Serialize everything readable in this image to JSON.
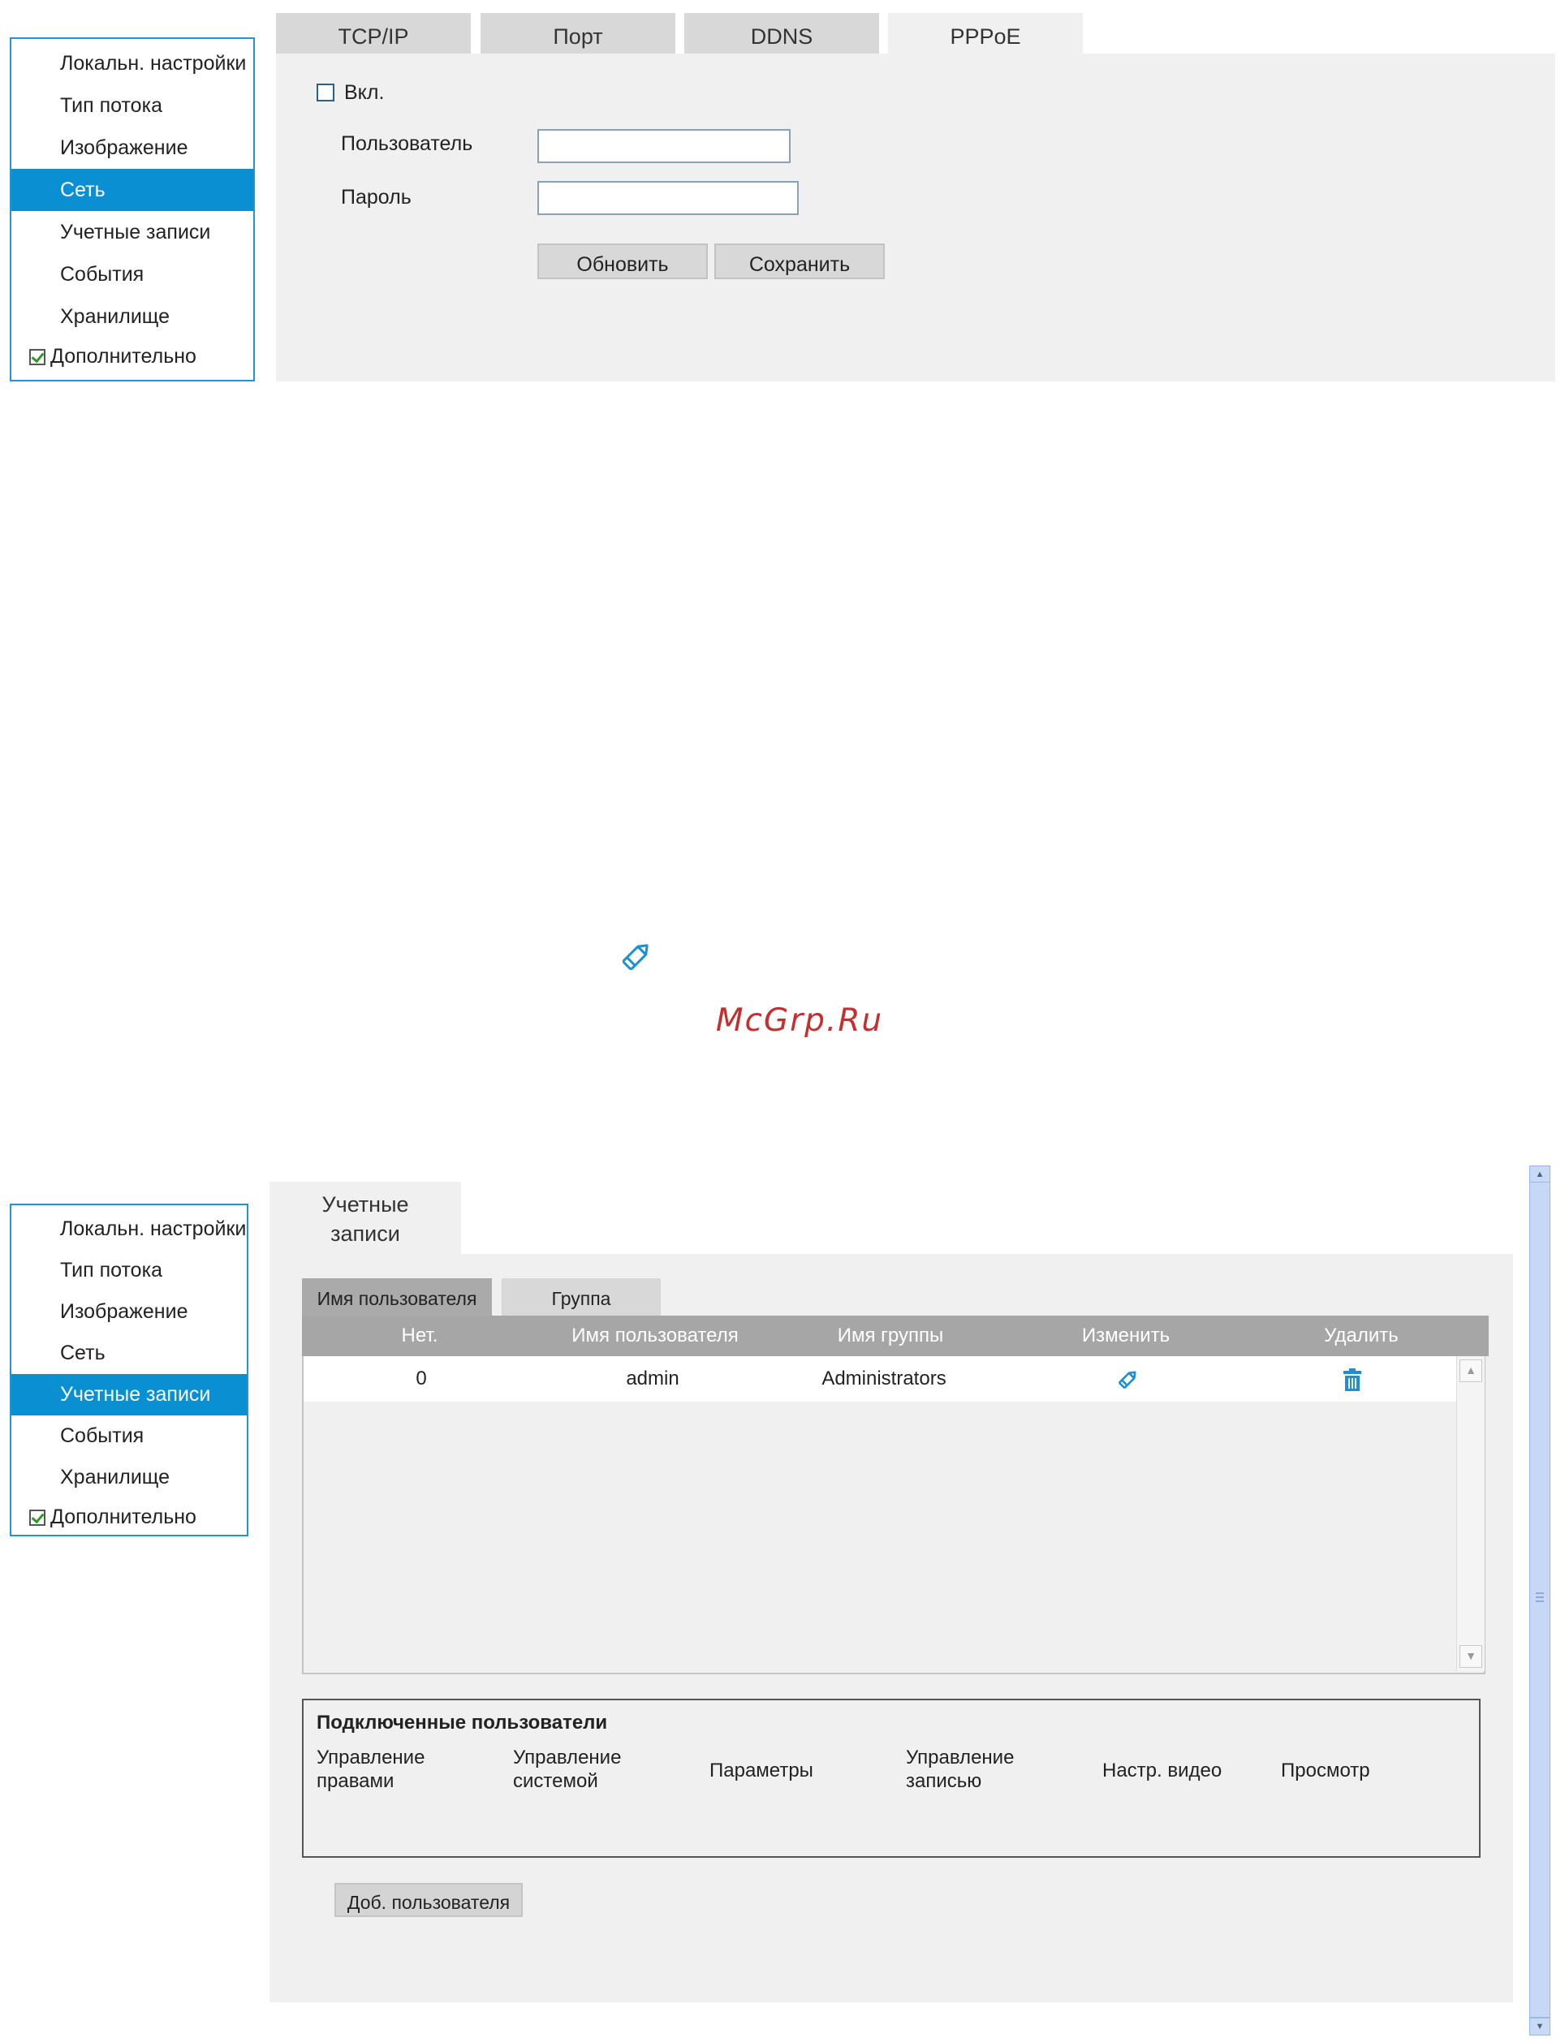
{
  "network_screen": {
    "sidebar": {
      "items": [
        {
          "label": "Локальн. настройки",
          "active": false
        },
        {
          "label": "Тип потока",
          "active": false
        },
        {
          "label": "Изображение",
          "active": false
        },
        {
          "label": "Сеть",
          "active": true
        },
        {
          "label": "Учетные записи",
          "active": false
        },
        {
          "label": "События",
          "active": false
        },
        {
          "label": "Хранилище",
          "active": false
        }
      ],
      "advanced": {
        "label": "Дополнительно",
        "checked": true
      }
    },
    "tabs": [
      "TCP/IP",
      "Порт",
      "DDNS",
      "PPPoE"
    ],
    "active_tab": "PPPoE",
    "pppoe": {
      "enable_label": "Вкл.",
      "enabled": false,
      "user_label": "Пользователь",
      "user_value": "",
      "password_label": "Пароль",
      "password_value": "",
      "refresh_button": "Обновить",
      "save_button": "Сохранить"
    }
  },
  "watermark": {
    "text": "McGrp.Ru",
    "icon": "pencil-icon"
  },
  "accounts_screen": {
    "sidebar": {
      "items": [
        {
          "label": "Локальн. настройки",
          "active": false
        },
        {
          "label": "Тип потока",
          "active": false
        },
        {
          "label": "Изображение",
          "active": false
        },
        {
          "label": "Сеть",
          "active": false
        },
        {
          "label": "Учетные записи",
          "active": true
        },
        {
          "label": "События",
          "active": false
        },
        {
          "label": "Хранилище",
          "active": false
        }
      ],
      "advanced": {
        "label": "Дополнительно",
        "checked": true
      }
    },
    "main_tab": {
      "line1": "Учетные",
      "line2": "записи"
    },
    "subtabs": [
      "Имя пользователя",
      "Группа"
    ],
    "active_subtab": "Имя пользователя",
    "table": {
      "headers": [
        "Нет.",
        "Имя пользователя",
        "Имя группы",
        "Изменить",
        "Удалить"
      ],
      "rows": [
        {
          "no": "0",
          "user": "admin",
          "group": "Administrators",
          "edit_icon": "pencil-icon",
          "delete_icon": "trash-icon"
        }
      ]
    },
    "connected": {
      "title": "Подключенные пользователи",
      "columns": [
        {
          "l1": "Управление",
          "l2": "правами"
        },
        {
          "l1": "Управление",
          "l2": "системой"
        },
        {
          "l1": "Параметры",
          "l2": ""
        },
        {
          "l1": "Управление",
          "l2": "записью"
        },
        {
          "l1": "Настр. видео",
          "l2": ""
        },
        {
          "l1": "Просмотр",
          "l2": ""
        }
      ]
    },
    "add_user_button": "Доб. пользователя"
  },
  "colors": {
    "accent": "#0a8fd3",
    "sidebar_border": "#1f95d6",
    "panel_bg": "#f0f0f0",
    "table_header": "#a6a6a6",
    "icon_blue": "#1d8fd6"
  }
}
